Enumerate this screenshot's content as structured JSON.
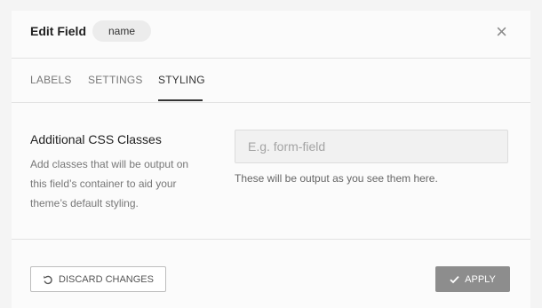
{
  "header": {
    "title": "Edit Field",
    "badge": "name",
    "close_glyph": "×"
  },
  "tabs": [
    {
      "label": "LABELS"
    },
    {
      "label": "SETTINGS"
    },
    {
      "label": "STYLING"
    }
  ],
  "active_tab": "STYLING",
  "section": {
    "title": "Additional CSS Classes",
    "description": "Add classes that will be output on this field’s container to aid your theme’s default styling."
  },
  "css_input": {
    "value": "",
    "placeholder": "E.g. form-field",
    "helper": "These will be output as you see them here."
  },
  "footer": {
    "discard_label": "DISCARD CHANGES",
    "apply_label": "APPLY"
  },
  "icons": {
    "discard": "undo-icon",
    "apply": "check-icon",
    "close": "close-icon"
  },
  "colors": {
    "apply_bg": "#8d8d8d",
    "active_tab": "#333333"
  }
}
